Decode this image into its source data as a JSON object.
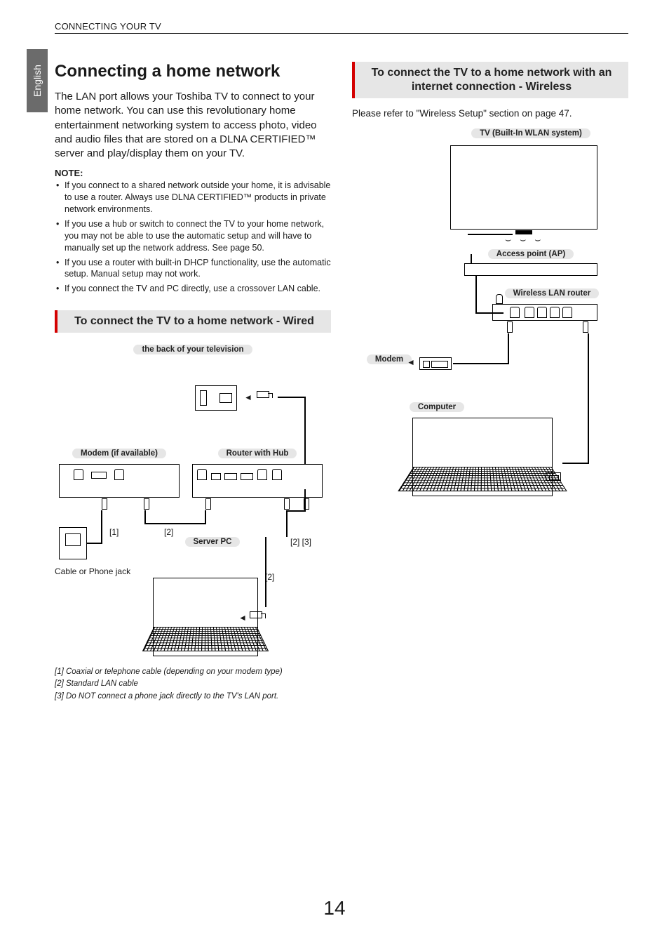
{
  "running_head": "CONNECTING YOUR TV",
  "side_tab": "English",
  "page_number": "14",
  "left": {
    "h1": "Connecting a home network",
    "intro": "The LAN port allows your Toshiba TV to connect to your home network. You can use this revolutionary home entertainment networking system to access photo, video and audio files that are stored on a DLNA CERTIFIED™ server and play/display them on your TV.",
    "note_label": "NOTE:",
    "notes": [
      "If you connect to a shared network outside your home, it is advisable to use a router. Always use DLNA CERTIFIED™ products in private network environments.",
      "If you use a hub or switch to connect the TV to your home network, you may not be able to use the automatic setup and will have to manually set up the network address. See page 50.",
      "If you use a router with built-in DHCP functionality, use the automatic setup. Manual setup may not work.",
      "If you connect the TV and PC directly, use a crossover LAN cable."
    ],
    "section_title": "To connect the TV to a home network - Wired",
    "labels": {
      "tv_back": "the back of your television",
      "modem": "Modem (if available)",
      "router": "Router with Hub",
      "server_pc": "Server PC",
      "cable_jack": "Cable or Phone jack",
      "ref1": "[1]",
      "ref2": "[2]",
      "ref23": "[2] [3]"
    },
    "footnotes": [
      "[1] Coaxial or telephone cable (depending on your modem type)",
      "[2] Standard LAN cable",
      "[3] Do NOT connect a phone jack directly to the TV's LAN port."
    ]
  },
  "right": {
    "section_title": "To connect the TV to a home network with an internet connection - Wireless",
    "ref_text": "Please refer to \"Wireless Setup\" section on page 47.",
    "labels": {
      "tv": "TV (Built-In WLAN system)",
      "ap": "Access point (AP)",
      "wrouter": "Wireless LAN router",
      "modem": "Modem",
      "computer": "Computer"
    }
  }
}
